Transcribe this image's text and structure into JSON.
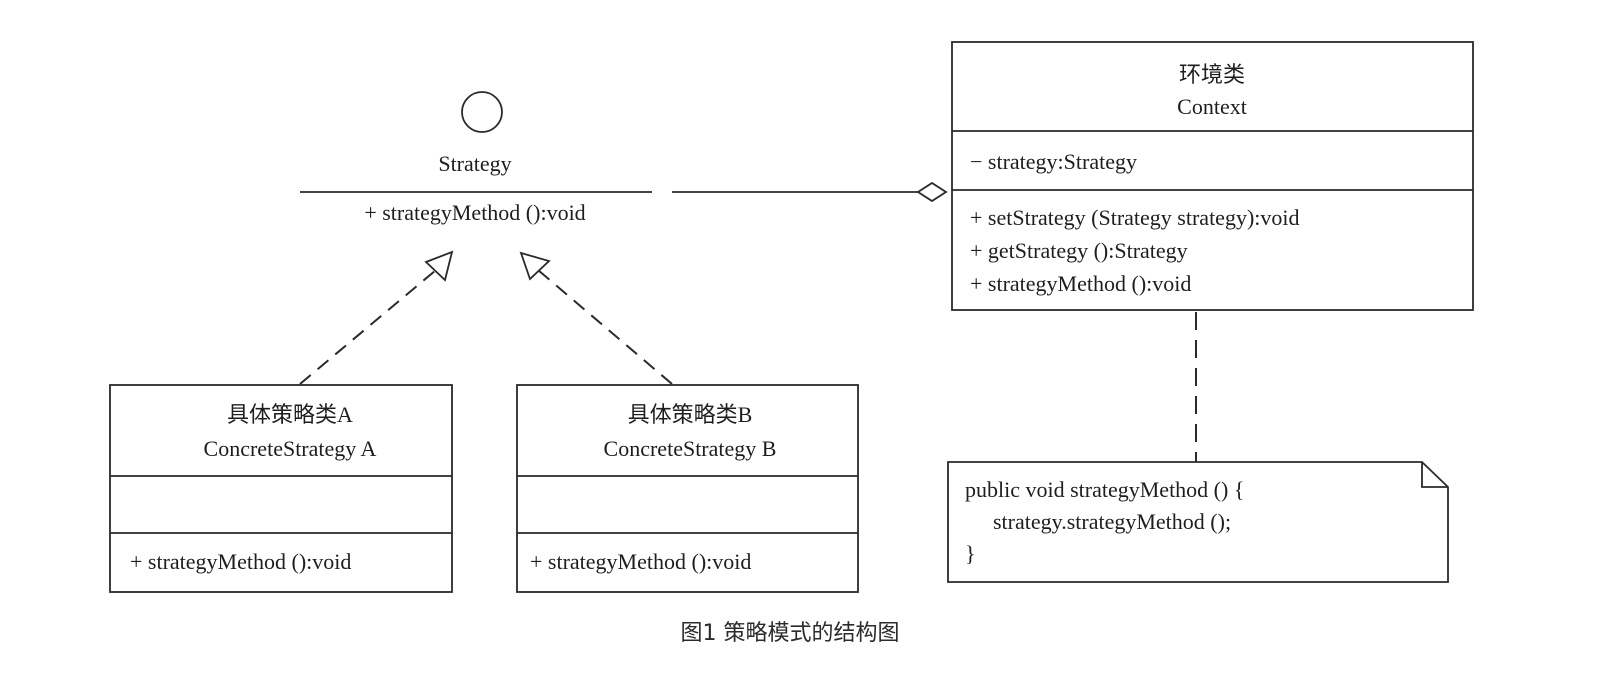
{
  "strategy": {
    "name": "Strategy",
    "method": "+ strategyMethod ():void"
  },
  "context": {
    "title_cn": "环境类",
    "title_en": "Context",
    "attribute": "− strategy:Strategy",
    "methods": [
      "+ setStrategy (Strategy strategy):void",
      "+ getStrategy ():Strategy",
      "+ strategyMethod ():void"
    ]
  },
  "concrete_a": {
    "title_cn": "具体策略类A",
    "title_en": "ConcreteStrategy  A",
    "method": "+ strategyMethod ():void"
  },
  "concrete_b": {
    "title_cn": "具体策略类B",
    "title_en": "ConcreteStrategy  B",
    "method": "+ strategyMethod ():void"
  },
  "note": {
    "lines": [
      "public void strategyMethod () {",
      "strategy.strategyMethod ();",
      "}"
    ]
  },
  "caption": "图1 策略模式的结构图"
}
